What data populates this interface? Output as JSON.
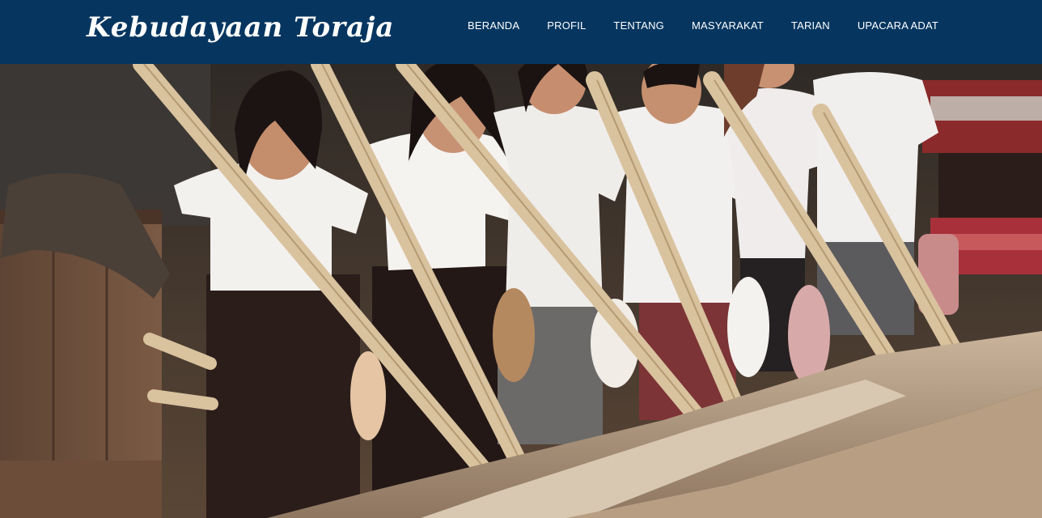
{
  "header": {
    "brand": "Kebudayaan Toraja",
    "nav": [
      {
        "label": "BERANDA"
      },
      {
        "label": "PROFIL"
      },
      {
        "label": "TENTANG"
      },
      {
        "label": "MASYARAKAT"
      },
      {
        "label": "TARIAN"
      },
      {
        "label": "UPACARA ADAT"
      }
    ]
  },
  "colors": {
    "navbar_bg": "#063660",
    "nav_text": "#ffffff"
  },
  "hero": {
    "image": "photo-women-pounding-rice-bamboo"
  }
}
